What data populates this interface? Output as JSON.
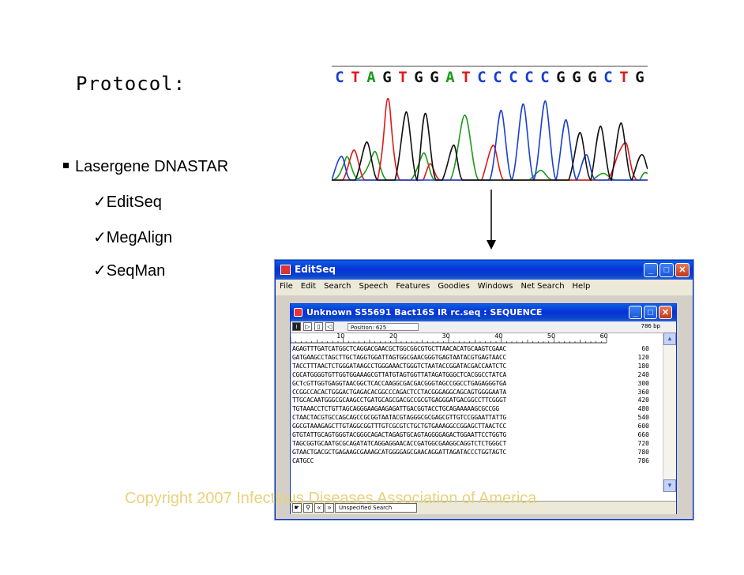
{
  "slide": {
    "title": "Protocol:",
    "bullet": "Lasergene DNASTAR",
    "subitems": [
      "EditSeq",
      "MegAlign",
      "SeqMan"
    ],
    "check_glyph": "✓",
    "copyright": "Copyright 2007 Infectious Diseases Association of America"
  },
  "chromatogram": {
    "bases": [
      "C",
      "T",
      "A",
      "G",
      "T",
      "G",
      "G",
      "A",
      "T",
      "C",
      "C",
      "C",
      "C",
      "C",
      "G",
      "G",
      "G",
      "C",
      "T",
      "G"
    ],
    "colors": {
      "A": "#1a9a1a",
      "C": "#1a3fd0",
      "G": "#111111",
      "T": "#e01818"
    }
  },
  "app": {
    "title": "EditSeq",
    "icon": "editseq-app-icon",
    "menu": [
      "File",
      "Edit",
      "Search",
      "Speech",
      "Features",
      "Goodies",
      "Windows",
      "Net Search",
      "Help"
    ],
    "controls": {
      "minimize": "_",
      "maximize": "□",
      "close": "✕"
    }
  },
  "doc": {
    "title": "Unknown S55691 Bact16S IR rc.seq : SEQUENCE",
    "position_label": "Position: 625",
    "length_label": "786 bp",
    "ruler_ticks": [
      "10",
      "20",
      "30",
      "40",
      "50",
      "60"
    ],
    "rows": [
      {
        "seq": "AGAGTTTGATCATGGCTCAGGACGAACGCTGGCGGCGTGCTTAACACATGCAAGTCGAAC",
        "num": "60"
      },
      {
        "seq": "GATGAAGCCTAGCTTGCTAGGTGGATTAGTGGCGAACGGGTGAGTAATACGTGAGTAACC",
        "num": "120"
      },
      {
        "seq": "TACCTTTAACTCTGGGATAAGCCTGGGAAACTGGGTCTAATACCGGATACGACCAATCTC",
        "num": "180"
      },
      {
        "seq": "CGCATGGGGTGTTGGTGGAAAGCGTTATGTAGTGGTTATAGATGGGCTCACGGCCTATCA",
        "num": "240"
      },
      {
        "seq": "GCTcGTTGGTGAGGTAACGGCTCACCAAGGCGACGACGGGTAGCCGGCCTGAGAGGGTGA",
        "num": "300"
      },
      {
        "seq": "CCGGCCACACTGGGACTGAGACACGGCCCAGACTCCTACGGGAGGCAGCAGTGGGGAATA",
        "num": "360"
      },
      {
        "seq": "TTGCACAATGGGCGCAAGCCTGATGCAGCGACGCCGCGTGAGGGATGACGGCCTTCGGGT",
        "num": "420"
      },
      {
        "seq": "TGTAAACCTCTGTTAGCAGGGAAGAAGAGATTGACGGTACCTGCAGAAAAAGCGCCGG",
        "num": "480"
      },
      {
        "seq": "CTAACTACGTGCCAGCAGCCGCGGTAATACGTAGGGCGCGAGCGTTGTCCGGAATTATTG",
        "num": "540"
      },
      {
        "seq": "GGCGTAAAGAGCTTGTAGGCGGTTTGTCGCGTCTGCTGTGAAAGGCCGGAGCTTAACTCC",
        "num": "600"
      },
      {
        "seq": "GTGTATTGCAGTGGGTACGGGCAGACTAGAGTGCAGTAGGGGAGACTGGAATTCCTGGTG",
        "num": "660"
      },
      {
        "seq": "TAGCGGTGCAATGCGCAGATATCAGGAGGAACACCGATGGCGAAGGCAGGTCTCTGGGCT",
        "num": "720"
      },
      {
        "seq": "GTAACTGACGCTGAGAAGCGAAAGCATGGGGAGCGAACAGGATTAGATACCCTGGTAGTC",
        "num": "780"
      },
      {
        "seq": "CATGCC",
        "num": "786"
      }
    ],
    "status_search": "Unspecified Search"
  }
}
